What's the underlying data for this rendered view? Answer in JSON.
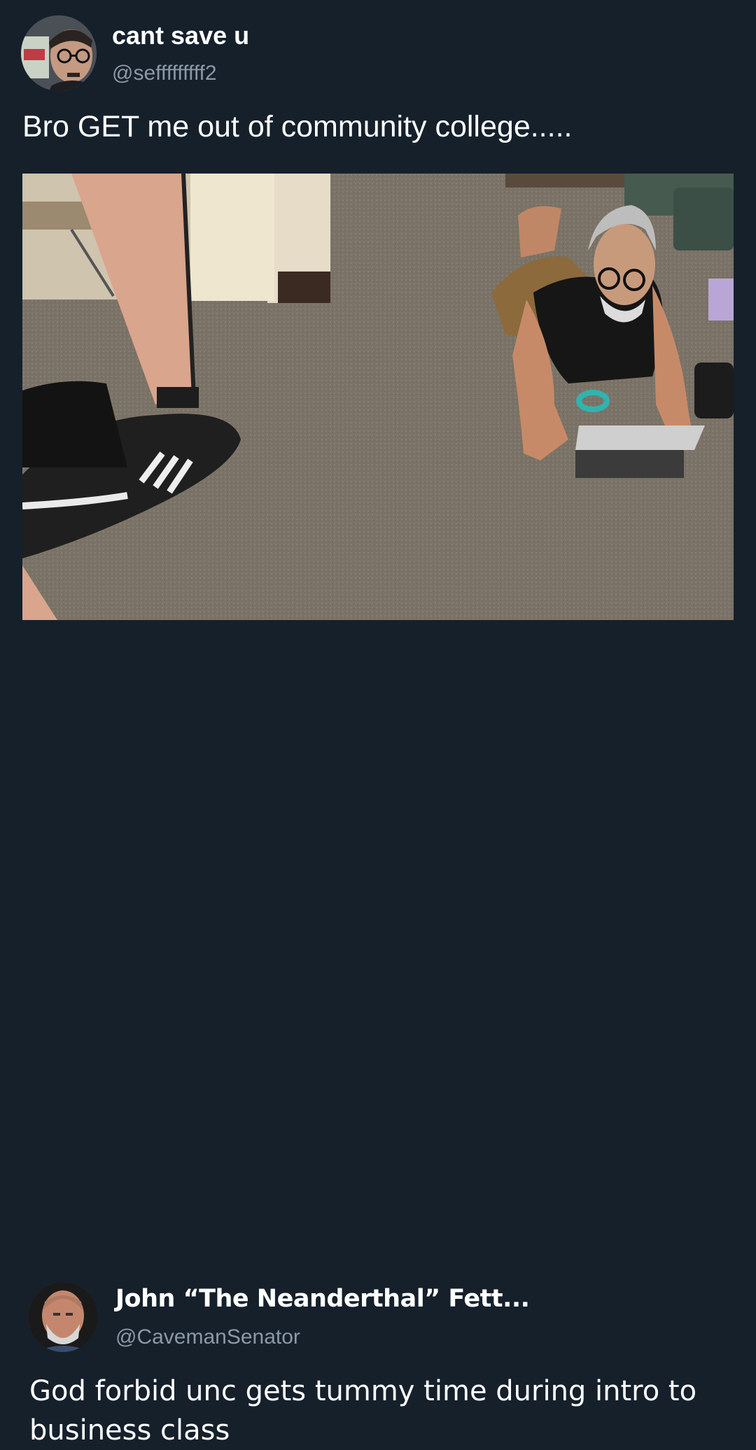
{
  "tweet": {
    "display_name": "cant save u",
    "handle": "@sefffffffff2",
    "text": "Bro GET me out of community college.....",
    "avatar_icon": "avatar-icon",
    "media_icon": "photo-icon"
  },
  "reply": {
    "display_name": "John “The Neanderthal” Fett...",
    "handle": "@CavemanSenator",
    "text": "God forbid unc gets tummy time during intro to business class",
    "avatar_icon": "avatar-icon"
  },
  "colors": {
    "background": "#15202b",
    "name": "#ffffff",
    "handle": "#8b98a5"
  }
}
